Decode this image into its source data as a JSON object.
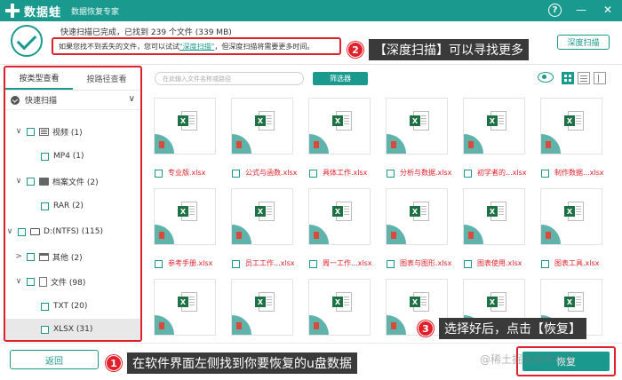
{
  "titlebar": {
    "app_name": "数据蛙",
    "subtitle": "数据恢复专家",
    "help": "?",
    "minimize": "—",
    "close": "✕"
  },
  "status": {
    "line": "快速扫描已完成，已找到 239 个文件 (339 MB)",
    "tip_before": "如果您找不到丢失的文件，您可以试试",
    "tip_link": "\"深度扫描\"",
    "tip_after": "，但深度扫描将需要更多时间。",
    "deep_scan_button": "深度扫描"
  },
  "callouts": [
    {
      "num": "2",
      "text": "【深度扫描】可以寻找更多"
    },
    {
      "num": "3",
      "text": "选择好后，点击【恢复】"
    },
    {
      "num": "1",
      "text": "在软件界面左侧找到你要恢复的u盘数据"
    }
  ],
  "left_panel": {
    "tabs": [
      "按类型查看",
      "按路径查看"
    ],
    "active_tab": "按类型查看",
    "scan_mode": "快速扫描",
    "tree": [
      {
        "label": "视频 (1)",
        "arrow": "∨",
        "icon": "video-icon"
      },
      {
        "label": "MP4 (1)",
        "arrow": "",
        "icon": ""
      },
      {
        "label": "档案文件 (2)",
        "arrow": "∨",
        "icon": "archive-icon"
      },
      {
        "label": "RAR (2)",
        "arrow": "",
        "icon": ""
      },
      {
        "label": "D:(NTFS) (115)",
        "arrow": "∨",
        "icon": "drive-icon"
      },
      {
        "label": "其他 (2)",
        "arrow": ">",
        "icon": "folder-icon"
      },
      {
        "label": "文件 (98)",
        "arrow": "∨",
        "icon": "document-icon"
      },
      {
        "label": "TXT (20)",
        "arrow": "",
        "icon": ""
      },
      {
        "label": "XLSX (31)",
        "arrow": "",
        "icon": ""
      }
    ]
  },
  "toolbar": {
    "search_placeholder": "在此输入文件名称或路径",
    "filter_button": "筛选器"
  },
  "files": [
    "专业版.xlsx",
    "公式与函数.xlsx",
    "具体工作.xlsx",
    "分析与数据.xlsx",
    "初学者的...xlsx",
    "制作数据...xlsx",
    "参考手册.xlsx",
    "员工工作...xlsx",
    "周一工作...xlsx",
    "图表与图形.xlsx",
    "图表使用.xlsx",
    "图表工具.xlsx",
    "",
    "",
    "",
    "",
    "",
    ""
  ],
  "bottom": {
    "back_button": "返回",
    "recover_button": "恢复",
    "watermark": "@稀土掘金技术社区"
  },
  "colors": {
    "brand": "#1a9a8e",
    "highlight": "#e0202a",
    "callout_bg": "#3a3a3a"
  }
}
